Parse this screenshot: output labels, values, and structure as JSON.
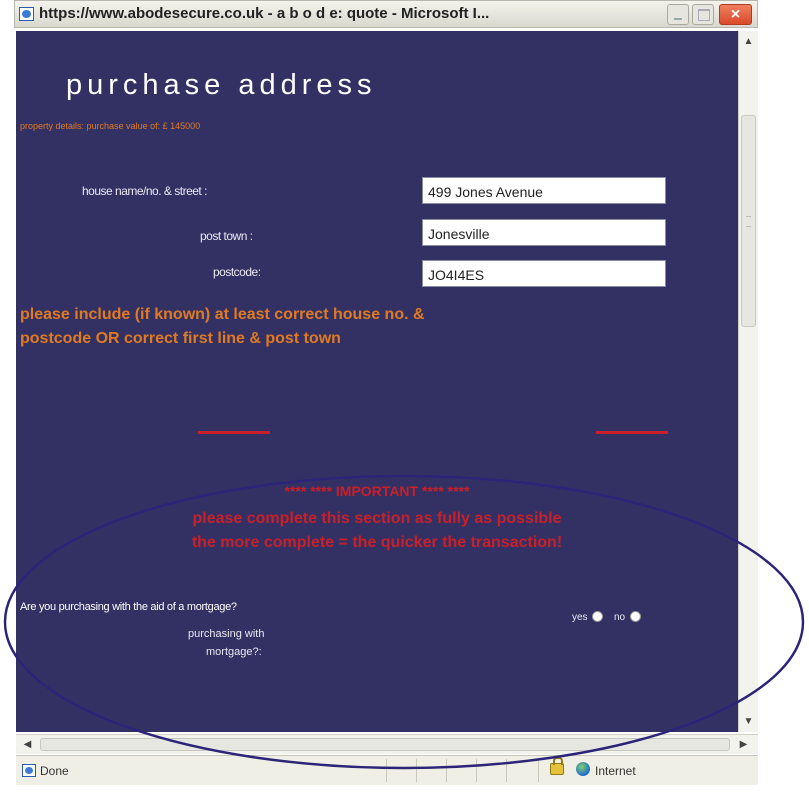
{
  "window": {
    "title": "https://www.abodesecure.co.uk - a b o d e: quote - Microsoft I...",
    "close_glyph": "×"
  },
  "page": {
    "heading": "purchase address",
    "subheading": "property details: purchase value of: £ 145000",
    "fields": {
      "street_label": "house name/no. & street :",
      "street_value": "499 Jones Avenue",
      "town_label": "post town :",
      "town_value": "Jonesville",
      "postcode_label": "postcode:",
      "postcode_value": "JO4I4ES"
    },
    "note_line1": "please include (if known) at least correct house no. &",
    "note_line2": "postcode OR correct first line & post town",
    "important_line1": "**** **** IMPORTANT **** ****",
    "important_line2": "please complete this section as fully as possible",
    "important_line3": "the more complete = the quicker the transaction!",
    "mortgage_question": "Are you purchasing with the aid of a mortgage?",
    "mortgage_label_line1": "purchasing with",
    "mortgage_label_line2": "mortgage?:",
    "radio_yes": "yes",
    "radio_no": "no"
  },
  "statusbar": {
    "status_text": "Done",
    "zone_text": "Internet"
  },
  "colors": {
    "page_bg": "#333163",
    "accent_orange": "#e07a22",
    "important_red": "#c8202a",
    "ellipse_stroke": "#2b2478"
  },
  "icons": [
    "ie-page-icon",
    "minimize-icon",
    "maximize-icon",
    "close-icon",
    "lock-icon",
    "globe-icon"
  ]
}
